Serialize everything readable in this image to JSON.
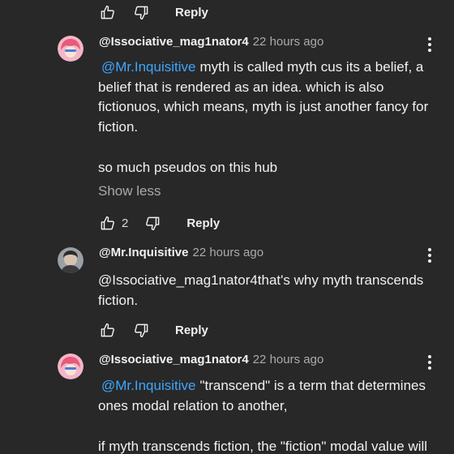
{
  "top_actions": {
    "reply": "Reply"
  },
  "comments": [
    {
      "author": "@Issociative_mag1nator4",
      "time": "22 hours ago",
      "mention": "@Mr.Inquisitive",
      "text": "myth is called myth cus its a belief, a belief that is rendered as an idea. which is also fictionuos, which means, myth is just another fancy for fiction.",
      "text2": "so much pseudos on this hub",
      "show_less": "Show less",
      "likes": "2",
      "reply": "Reply",
      "avatar_colors": {
        "bg": "#f3b6c8",
        "hair": "#e85a7a",
        "face": "#fbe3d6"
      }
    },
    {
      "author": "@Mr.Inquisitive",
      "time": "22 hours ago",
      "text": "@Issociative_mag1nator4that's why myth transcends fiction.",
      "reply": "Reply",
      "avatar_colors": {
        "bg": "#9aa0a6",
        "hair": "#2b2b2b",
        "face": "#d7c2b0"
      }
    },
    {
      "author": "@Issociative_mag1nator4",
      "time": "22 hours ago",
      "mention": "@Mr.Inquisitive",
      "text": "\"transcend\" is a term that determines ones modal relation to another,",
      "text2": "if myth transcends fiction, the \"fiction\" modal value will"
    }
  ]
}
